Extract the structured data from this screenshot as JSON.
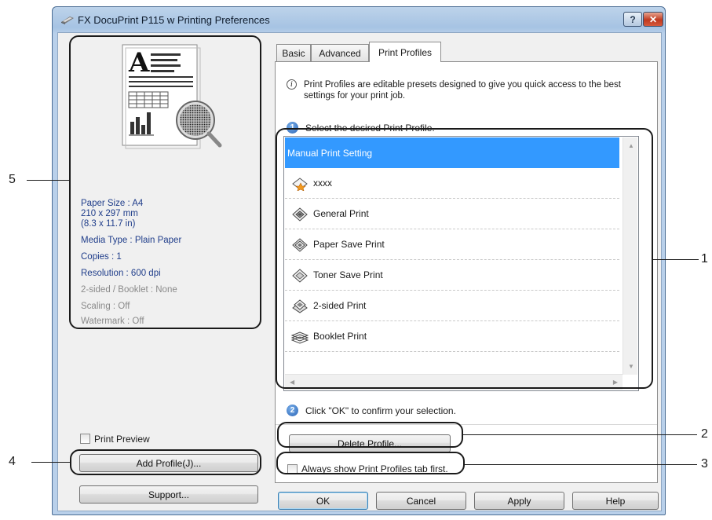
{
  "window": {
    "title": "FX DocuPrint P115 w Printing Preferences",
    "help_label": "?",
    "close_label": "✕"
  },
  "preview_info": {
    "paper_size": "Paper Size : A4",
    "paper_mm": "210 x 297 mm",
    "paper_in": "(8.3 x 11.7 in)",
    "media_type": "Media Type : Plain Paper",
    "copies": "Copies : 1",
    "resolution": "Resolution : 600 dpi",
    "two_sided": "2-sided / Booklet : None",
    "scaling": "Scaling : Off",
    "watermark": "Watermark : Off"
  },
  "left": {
    "print_preview_label": "Print Preview",
    "add_profile_label": "Add Profile(J)...",
    "support_label": "Support..."
  },
  "tabs": [
    {
      "label": "Basic"
    },
    {
      "label": "Advanced"
    },
    {
      "label": "Print Profiles"
    }
  ],
  "print_profiles": {
    "description": "Print Profiles are editable presets designed to give you quick access to the best settings for your print job.",
    "step1_num": "1",
    "step1_text": "Select the desired Print Profile.",
    "profiles": [
      {
        "label": "Manual Print Setting",
        "icon": "none"
      },
      {
        "label": "xxxx",
        "icon": "custom-profile-icon"
      },
      {
        "label": "General Print",
        "icon": "general-print-icon"
      },
      {
        "label": "Paper Save Print",
        "icon": "paper-save-icon"
      },
      {
        "label": "Toner Save Print",
        "icon": "toner-save-icon"
      },
      {
        "label": "2-sided Print",
        "icon": "two-sided-icon"
      },
      {
        "label": "Booklet Print",
        "icon": "booklet-icon"
      }
    ],
    "step2_num": "2",
    "step2_text": "Click \"OK\" to confirm your selection.",
    "delete_label": "Delete Profile...",
    "always_show_label": "Always show Print Profiles tab first."
  },
  "footer": {
    "ok_label": "OK",
    "cancel_label": "Cancel",
    "apply_label": "Apply",
    "help_label": "Help"
  },
  "callouts": {
    "c1": "1",
    "c2": "2",
    "c3": "3",
    "c4": "4",
    "c5": "5"
  },
  "colors": {
    "selection": "#3399ff",
    "info_text": "#1f3d8a",
    "disabled_text": "#8a8a8a"
  }
}
